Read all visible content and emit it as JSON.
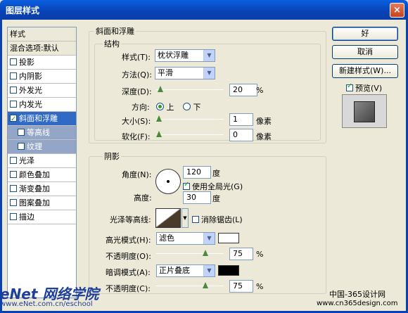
{
  "window": {
    "title": "图层样式",
    "close": "×"
  },
  "styles_list": {
    "header": "样式",
    "blend": "混合选项:默认",
    "items": [
      {
        "label": "投影",
        "checked": false
      },
      {
        "label": "内阴影",
        "checked": false
      },
      {
        "label": "外发光",
        "checked": false
      },
      {
        "label": "内发光",
        "checked": false
      },
      {
        "label": "斜面和浮雕",
        "checked": true
      },
      {
        "label": "等高线",
        "checked": false
      },
      {
        "label": "纹理",
        "checked": false
      },
      {
        "label": "光泽",
        "checked": false
      },
      {
        "label": "颜色叠加",
        "checked": false
      },
      {
        "label": "渐变叠加",
        "checked": false
      },
      {
        "label": "图案叠加",
        "checked": false
      },
      {
        "label": "描边",
        "checked": false
      }
    ]
  },
  "bevel": {
    "group_title": "斜面和浮雕",
    "structure_title": "结构",
    "style_label": "样式(T):",
    "style_value": "枕状浮雕",
    "method_label": "方法(Q):",
    "method_value": "平滑",
    "depth_label": "深度(D):",
    "depth_value": "20",
    "depth_unit": "%",
    "depth_level": 0.02,
    "direction_label": "方向:",
    "dir_up": "上",
    "dir_down": "下",
    "size_label": "大小(S):",
    "size_value": "1",
    "size_unit": "像素",
    "size_level": 0.0,
    "soften_label": "软化(F):",
    "soften_value": "0",
    "soften_unit": "像素",
    "soften_level": 0.0
  },
  "shading": {
    "title": "阴影",
    "angle_label": "角度(N):",
    "angle_value": "120",
    "angle_unit": "度",
    "global_light": "使用全局光(G)",
    "global_light_checked": true,
    "altitude_label": "高度:",
    "altitude_value": "30",
    "altitude_unit": "度",
    "gloss_label": "光泽等高线:",
    "antialias": "消除锯齿(L)",
    "antialias_checked": false,
    "highlight_label": "高光模式(H):",
    "highlight_value": "滤色",
    "highlight_color": "#ffffff",
    "hl_opacity_label": "不透明度(O):",
    "hl_opacity_value": "75",
    "hl_opacity_unit": "%",
    "hl_opacity_level": 0.75,
    "shadow_label": "暗调模式(A):",
    "shadow_value": "正片叠底",
    "shadow_color": "#000000",
    "sh_opacity_label": "不透明度(C):",
    "sh_opacity_value": "75",
    "sh_opacity_unit": "%",
    "sh_opacity_level": 0.75
  },
  "buttons": {
    "ok": "好",
    "cancel": "取消",
    "new_style": "新建样式(W)...",
    "preview": "预览(V)",
    "preview_checked": true
  },
  "watermarks": {
    "left": "eNet 网络学院",
    "left_url": "www.eNet.com.cn/eschool",
    "right": "中国-365设计网",
    "right_url": "www.cn365design.com"
  }
}
